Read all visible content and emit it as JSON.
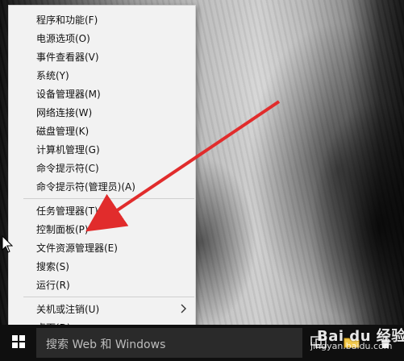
{
  "menu": {
    "items": [
      {
        "label": "程序和功能(F)"
      },
      {
        "label": "电源选项(O)"
      },
      {
        "label": "事件查看器(V)"
      },
      {
        "label": "系统(Y)"
      },
      {
        "label": "设备管理器(M)"
      },
      {
        "label": "网络连接(W)"
      },
      {
        "label": "磁盘管理(K)"
      },
      {
        "label": "计算机管理(G)"
      },
      {
        "label": "命令提示符(C)"
      },
      {
        "label": "命令提示符(管理员)(A)"
      },
      {
        "label": "任务管理器(T)"
      },
      {
        "label": "控制面板(P)"
      },
      {
        "label": "文件资源管理器(E)"
      },
      {
        "label": "搜索(S)"
      },
      {
        "label": "运行(R)"
      },
      {
        "label": "关机或注销(U)"
      },
      {
        "label": "桌面(D)"
      }
    ]
  },
  "taskbar": {
    "search_placeholder": "搜索 Web 和 Windows"
  },
  "watermark": {
    "title": "Bai du 经验",
    "url": "jingyan.baidu.com"
  },
  "colors": {
    "menu_bg": "#f2f2f2",
    "taskbar_bg": "#0f0f0f",
    "annotation_arrow": "#e12c2c"
  }
}
